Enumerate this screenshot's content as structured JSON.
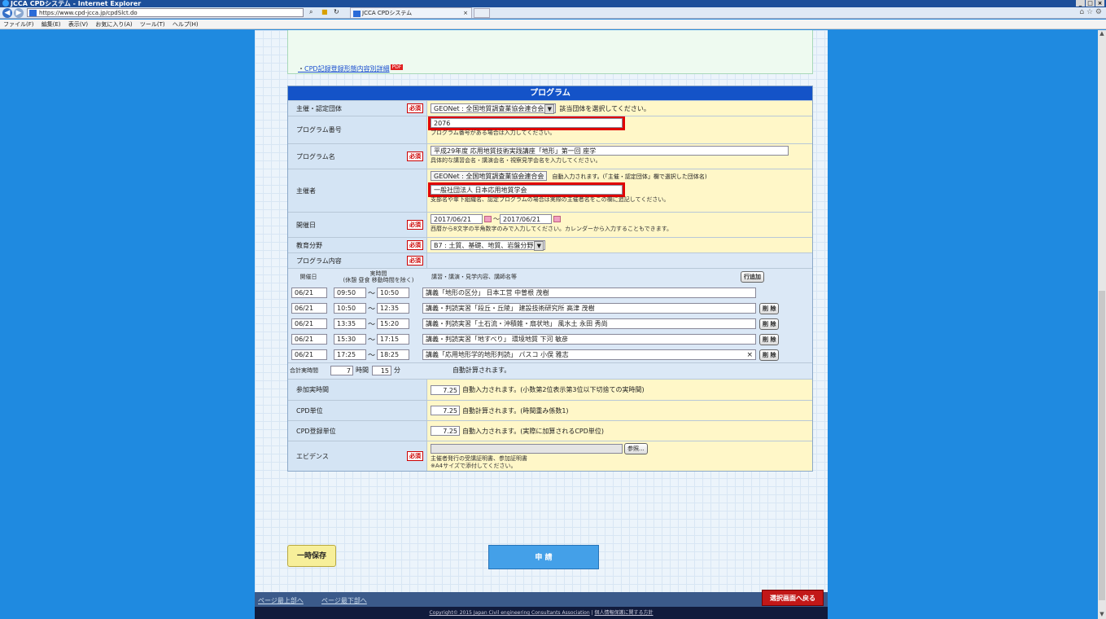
{
  "window": {
    "title": "JCCA CPDシステム - Internet Explorer",
    "buttons": [
      "_",
      "□",
      "×"
    ]
  },
  "browser": {
    "url": "https://www.cpd-jcca.jp/cpdSlct.do",
    "tab_title": "JCCA CPDシステム",
    "tab_close": "×"
  },
  "menu": [
    "ファイル(F)",
    "編集(E)",
    "表示(V)",
    "お気に入り(A)",
    "ツール(T)",
    "ヘルプ(H)"
  ],
  "notice": {
    "link": "CPD記録登録形態内容別詳細",
    "pdf_badge": "PDF"
  },
  "form": {
    "header": "プログラム",
    "required_label": "必須",
    "organizer_group": {
      "label": "主催・認定団体",
      "value": "GEONet : 全国地質調査業協会連合会",
      "help": "該当団体を選択してください。"
    },
    "program_number": {
      "label": "プログラム番号",
      "value": "2076",
      "help": "プログラム番号がある場合は入力してください。"
    },
    "program_name": {
      "label": "プログラム名",
      "value": "平成29年度 応用地質技術実践講座「地形」第一回 座学",
      "help": "具体的な講習会名・講演会名・視察見学会名を入力してください。"
    },
    "host": {
      "label": "主催者",
      "auto_value": "GEONet : 全国地質調査業協会連合会",
      "auto_help": "自動入力されます。(「主催・認定団体」欄で選択した団体名)",
      "value": "一般社団法人 日本応用地質学会",
      "help": "支部名や傘下組織名、認定プログラムの場合は実際の主催者名をこの欄に追記してください。"
    },
    "dates": {
      "label": "開催日",
      "from": "2017/06/21",
      "sep": "～",
      "to": "2017/06/21",
      "help": "西暦から8文字の半角数字のみで入力してください。カレンダーから入力することもできます。"
    },
    "field": {
      "label": "教育分野",
      "value": "B7 : 土質、基礎、地質、岩盤分野"
    },
    "content": {
      "label": "プログラム内容"
    },
    "table": {
      "col_date": "開催日",
      "col_time_top": "実時間",
      "col_time": "(休憩 昼食 移動時間を除く)",
      "col_content": "講習・講演・見学内容、講師名等",
      "add_row": "行追加",
      "delete": "削 除",
      "clear": "×",
      "rows": [
        {
          "date": "06/21",
          "start": "09:50",
          "sep": "～",
          "end": "10:50",
          "content": "講義「地形の区分」 日本工営 中曽根 茂樹"
        },
        {
          "date": "06/21",
          "start": "10:50",
          "sep": "～",
          "end": "12:35",
          "content": "講義・判読実習「段丘・丘陵」 建設技術研究所 高津 茂樹"
        },
        {
          "date": "06/21",
          "start": "13:35",
          "sep": "～",
          "end": "15:20",
          "content": "講義・判読実習「土石流・沖積錐・扇状地」 風水土 永田 秀尚"
        },
        {
          "date": "06/21",
          "start": "15:30",
          "sep": "～",
          "end": "17:15",
          "content": "講義・判読実習「地すべり」 環境地質 下河 敏彦"
        },
        {
          "date": "06/21",
          "start": "17:25",
          "sep": "～",
          "end": "18:25",
          "content": "講義「応用地形学的地形判読」 パスコ 小俣 雅志"
        }
      ],
      "total_label": "合計実時間",
      "hours": "7",
      "hours_unit": "時間",
      "minutes": "15",
      "minutes_unit": "分",
      "total_help": "自動計算されます。"
    },
    "attend_time": {
      "label": "参加実時間",
      "value": "7.25",
      "help": "自動入力されます。(小数第2位表示第3位以下切捨ての実時間)"
    },
    "cpd_unit": {
      "label": "CPD単位",
      "value": "7.25",
      "help": "自動計算されます。(時間重み係数1)"
    },
    "cpd_reg_unit": {
      "label": "CPD登録単位",
      "value": "7.25",
      "help": "自動入力されます。(実際に加算されるCPD単位)"
    },
    "evidence": {
      "label": "エビデンス",
      "browse": "参照...",
      "help1": "主催者発行の受講証明書、参加証明書",
      "help2": "※A4サイズで添付してください。"
    }
  },
  "actions": {
    "save": "一時保存",
    "apply": "申 請"
  },
  "footer": {
    "top_link": "ページ最上部へ",
    "bottom_link": "ページ最下部へ",
    "back": "選択画面へ戻る",
    "copyright": "Copyright© 2015 Japan Civil engineering Consultants Association",
    "privacy": "個人情報保護に関する方針"
  }
}
